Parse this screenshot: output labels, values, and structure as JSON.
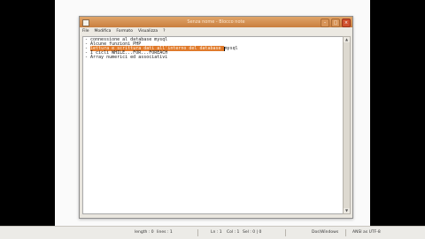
{
  "window": {
    "title": "Senza nome - Blocco note"
  },
  "menu": [
    {
      "label": "File"
    },
    {
      "label": "Modifica"
    },
    {
      "label": "Formato"
    },
    {
      "label": "Visualizza"
    },
    {
      "label": "?"
    }
  ],
  "editor": {
    "lines": [
      {
        "text": "- connessione al database mysql"
      },
      {
        "text": "- Alcune funzioni PHP"
      },
      {
        "before": "- ",
        "selected": "lettura e scrittura dati all'interno del database ",
        "after": "mysql"
      },
      {
        "text": "- I cicli WHILE...FOR...FOREACH"
      },
      {
        "text": "- Array numerici ed associativi"
      }
    ]
  },
  "status": {
    "length": "length : 0",
    "lines": "lines : 1",
    "ln": "Ln : 1",
    "col": "Col : 1",
    "sel": "Sel : 0 | 0",
    "eol": "Dos\\Windows",
    "encoding": "ANSI as UTF-8"
  }
}
